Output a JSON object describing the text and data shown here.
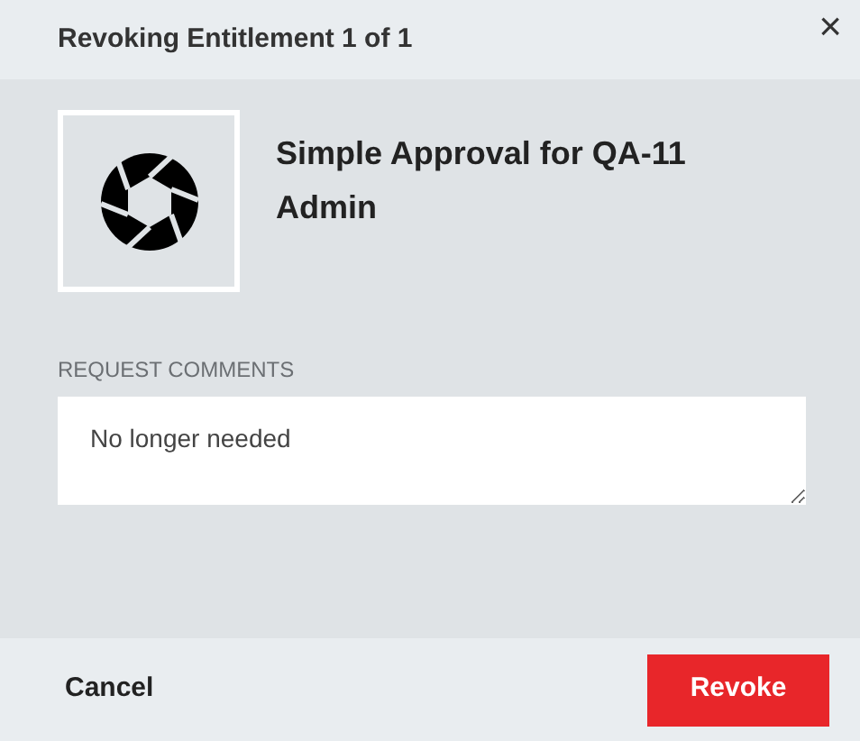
{
  "dialog": {
    "title": "Revoking Entitlement 1 of 1",
    "close": "×"
  },
  "entitlement": {
    "name": "Simple Approval for QA-11 Admin"
  },
  "comments": {
    "label": "REQUEST COMMENTS",
    "value": "No longer needed"
  },
  "buttons": [
    {
      "label": "Cancel",
      "kind": "secondary"
    },
    {
      "label": "Revoke",
      "kind": "primary"
    }
  ]
}
